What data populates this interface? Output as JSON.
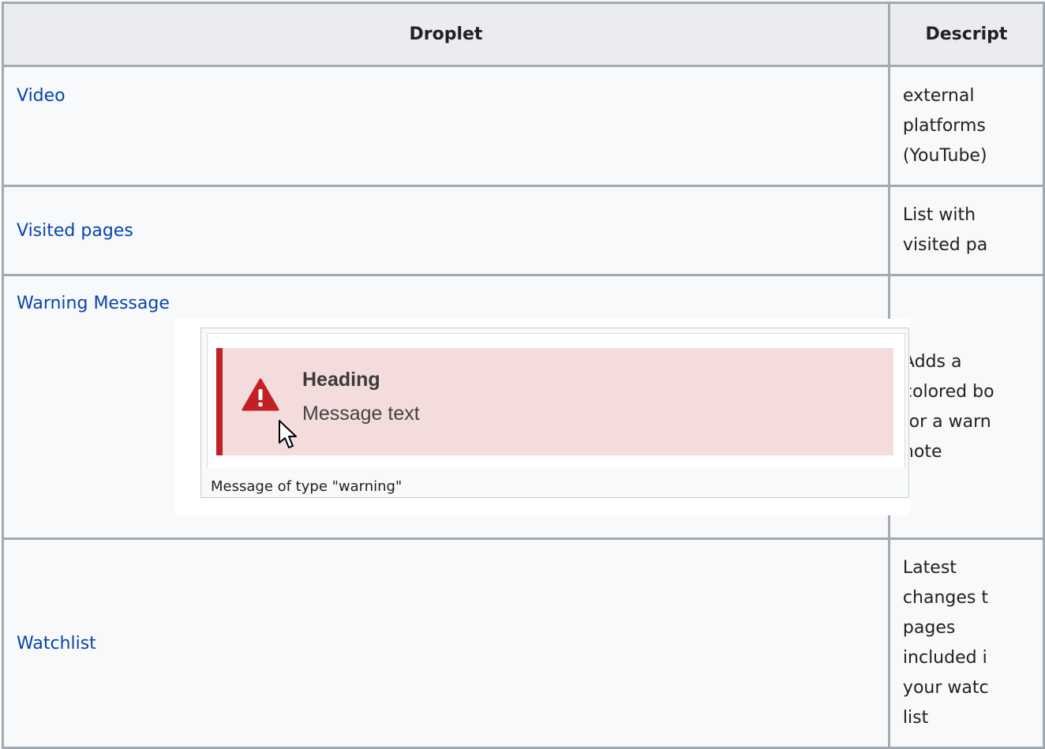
{
  "table": {
    "headers": [
      "Droplet",
      "Descript"
    ],
    "rows": [
      {
        "droplet": "Video",
        "description_lines": [
          "external",
          "platforms",
          "(YouTube)"
        ]
      },
      {
        "droplet": "Visited pages",
        "description_lines": [
          "List with",
          "visited pa"
        ]
      },
      {
        "droplet": "Warning Message",
        "description_lines": [
          "Adds a",
          "colored bo",
          "for a warn",
          "note"
        ]
      },
      {
        "droplet": "Watchlist",
        "description_lines": [
          "Latest",
          "changes t",
          "pages",
          "included i",
          "your watc",
          "list"
        ]
      }
    ]
  },
  "warning_preview": {
    "heading": "Heading",
    "message": "Message text",
    "caption": "Message of type \"warning\"",
    "icon": "warning-triangle-icon",
    "cursor_icon": "mouse-pointer-icon",
    "colors": {
      "background": "#f4dcdd",
      "accent": "#c32026"
    }
  },
  "colors": {
    "link": "#0645ad",
    "header_bg": "#eaecf0",
    "border": "#a2a9b1"
  }
}
